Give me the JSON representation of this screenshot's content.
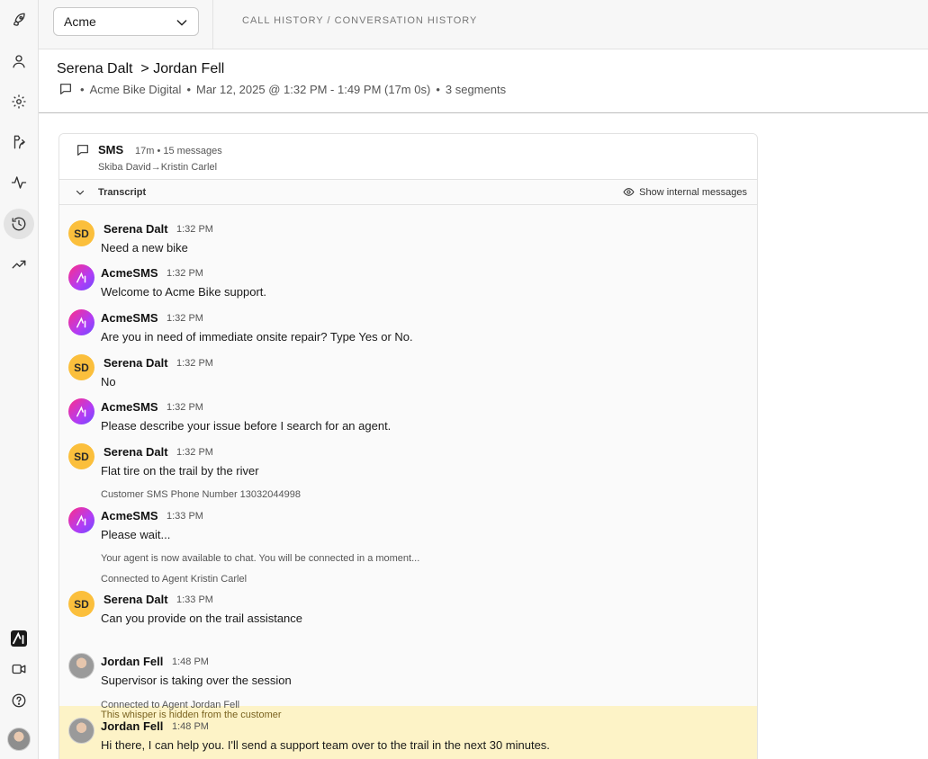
{
  "rail": {
    "icons": [
      "rocket-icon",
      "user-icon",
      "gear-icon",
      "routing-icon",
      "activity-icon",
      "history-icon",
      "trending-icon"
    ],
    "active": "history-icon",
    "bottom_icons": [
      "brand-logo-icon",
      "video-icon",
      "help-icon",
      "user-avatar"
    ]
  },
  "topbar": {
    "org_select_value": "Acme",
    "breadcrumb": "CALL HISTORY / CONVERSATION HISTORY"
  },
  "header": {
    "title_from": "Serena Dalt",
    "title_sep": ">",
    "title_to": "Jordan Fell",
    "meta_dot": "•",
    "meta_source": "Acme Bike Digital",
    "meta_time": "Mar 12, 2025 @ 1:32 PM - 1:49 PM (17m 0s)",
    "meta_segments": "3 segments"
  },
  "card": {
    "channel": "SMS",
    "summary": "17m • 15 messages",
    "route": "Skiba David→Kristin Carlel",
    "transcript_label": "Transcript",
    "show_internal_label": "Show internal messages"
  },
  "messages": [
    {
      "type": "customer",
      "initials": "SD",
      "sender": "Serena Dalt",
      "time": "1:32 PM",
      "text": "Need a new bike"
    },
    {
      "type": "bot",
      "sender": "AcmeSMS",
      "time": "1:32 PM",
      "text": "Welcome to Acme Bike support."
    },
    {
      "type": "bot",
      "sender": "AcmeSMS",
      "time": "1:32 PM",
      "text": "Are you in need of immediate onsite repair? Type Yes or No."
    },
    {
      "type": "customer",
      "initials": "SD",
      "sender": "Serena Dalt",
      "time": "1:32 PM",
      "text": "No"
    },
    {
      "type": "bot",
      "sender": "AcmeSMS",
      "time": "1:32 PM",
      "text": "Please describe your issue before I search for an agent."
    },
    {
      "type": "customer",
      "initials": "SD",
      "sender": "Serena Dalt",
      "time": "1:32 PM",
      "text": "Flat tire on the trail by the river"
    },
    {
      "type": "bot",
      "sender": "AcmeSMS",
      "time": "1:33 PM",
      "text": "Please wait..."
    },
    {
      "type": "customer",
      "initials": "SD",
      "sender": "Serena Dalt",
      "time": "1:33 PM",
      "text": "Can you provide on the trail assistance"
    },
    {
      "type": "agent",
      "sender": "Jordan Fell",
      "time": "1:48 PM",
      "text": "Supervisor is taking over the session"
    },
    {
      "type": "agent",
      "sender": "Jordan Fell",
      "time": "1:48 PM",
      "text": "Hi there, I can help you. I'll send a support team over to the trail in the next 30 minutes."
    }
  ],
  "system": [
    "Customer SMS Phone Number 13032044998",
    "Your agent is now available to chat. You will be connected in a moment...",
    "Connected to Agent Kristin Carlel",
    "This whisper is hidden from the customer",
    "Connected to Agent Jordan Fell"
  ],
  "colors": {
    "customer_avatar": "#fbbf3c",
    "whisper_bg": "#fdf3c7",
    "whisper_text": "#7a6320",
    "bot_gradient_start": "#ff2d86",
    "bot_gradient_end": "#6c4cff"
  }
}
